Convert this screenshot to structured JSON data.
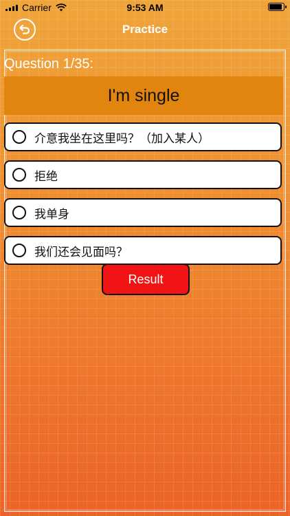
{
  "status_bar": {
    "carrier": "Carrier",
    "time": "9:53 AM"
  },
  "nav": {
    "title": "Practice",
    "back_icon": "back-arrow-icon"
  },
  "quiz": {
    "counter": "Question 1/35:",
    "prompt": "I'm single",
    "options": [
      {
        "label": "介意我坐在这里吗？（加入某人）"
      },
      {
        "label": "拒绝"
      },
      {
        "label": "我单身"
      },
      {
        "label": "我们还会见面吗？"
      }
    ],
    "result_label": "Result"
  },
  "colors": {
    "background_top": "#efa53a",
    "background_bottom": "#ec6328",
    "prompt_band": "#e2850f",
    "result_button": "#f01414"
  }
}
